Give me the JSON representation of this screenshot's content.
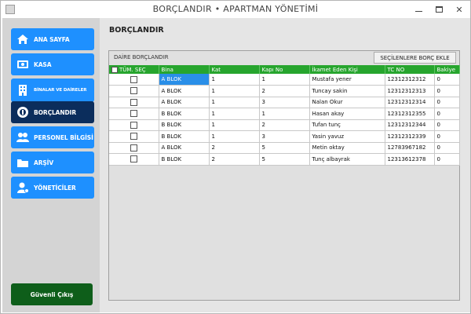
{
  "window": {
    "title": "BORÇLANDIR • APARTMAN YÖNETİMİ"
  },
  "sidebar": {
    "items": [
      {
        "label": "ANA SAYFA",
        "icon": "home-icon"
      },
      {
        "label": "KASA",
        "icon": "cash-icon"
      },
      {
        "label": "BİNALAR VE DAİRELER",
        "icon": "building-icon"
      },
      {
        "label": "BORÇLANDIR",
        "icon": "debt-icon"
      },
      {
        "label": "PERSONEL BİLGİSİ",
        "icon": "staff-icon"
      },
      {
        "label": "ARŞİV",
        "icon": "archive-icon"
      },
      {
        "label": "YÖNETİCİLER",
        "icon": "admin-icon"
      }
    ],
    "active_index": 3,
    "logout_label": "Güvenli Çıkış"
  },
  "main": {
    "title": "BORÇLANDIR",
    "panel_label": "DAİRE BORÇLANDIR",
    "assign_button": "SEÇİLENLERE BORÇ EKLE",
    "columns": [
      "TÜM. SEÇ",
      "Bina",
      "Kat",
      "Kapı No",
      "İkamet Eden Kişi",
      "TC NO",
      "Bakiye"
    ],
    "rows": [
      {
        "bina": "A BLOK",
        "kat": "1",
        "kapi": "1",
        "kisi": "Mustafa yener",
        "tc": "12312312312",
        "bakiye": "0"
      },
      {
        "bina": "A BLOK",
        "kat": "1",
        "kapi": "2",
        "kisi": "Tuncay sakin",
        "tc": "12312312313",
        "bakiye": "0"
      },
      {
        "bina": "A BLOK",
        "kat": "1",
        "kapi": "3",
        "kisi": "Nalan Okur",
        "tc": "12312312314",
        "bakiye": "0"
      },
      {
        "bina": "B BLOK",
        "kat": "1",
        "kapi": "1",
        "kisi": "Hasan akay",
        "tc": "12312312355",
        "bakiye": "0"
      },
      {
        "bina": "B BLOK",
        "kat": "1",
        "kapi": "2",
        "kisi": "Tufan tunç",
        "tc": "12312312344",
        "bakiye": "0"
      },
      {
        "bina": "B BLOK",
        "kat": "1",
        "kapi": "3",
        "kisi": "Yasin yavuz",
        "tc": "12312312339",
        "bakiye": "0"
      },
      {
        "bina": "A BLOK",
        "kat": "2",
        "kapi": "5",
        "kisi": "Metin oktay",
        "tc": "12783967182",
        "bakiye": "0"
      },
      {
        "bina": "B BLOK",
        "kat": "2",
        "kapi": "5",
        "kisi": "Tunç albayrak",
        "tc": "12313612378",
        "bakiye": "0"
      }
    ]
  },
  "colors": {
    "nav_blue": "#1e90ff",
    "nav_active": "#0b2d5c",
    "logout_green": "#0e5e1a",
    "grid_header_green": "#27a52e",
    "selection_blue": "#2a8fe8"
  }
}
